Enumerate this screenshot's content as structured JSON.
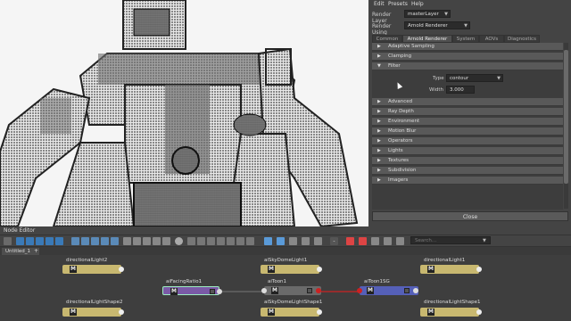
{
  "menubar": {
    "edit": "Edit",
    "presets": "Presets",
    "help": "Help"
  },
  "render_layer": {
    "label": "Render Layer",
    "value": "masterLayer"
  },
  "render_using": {
    "label": "Render Using",
    "value": "Arnold Renderer"
  },
  "tabs": [
    "Common",
    "Arnold Renderer",
    "System",
    "AOVs",
    "Diagnostics"
  ],
  "active_tab": "Arnold Renderer",
  "sections_top": [
    "Adaptive Sampling",
    "Clamping",
    "Filter"
  ],
  "filter": {
    "type_label": "Type",
    "type_value": "contour",
    "width_label": "Width",
    "width_value": "3.000"
  },
  "sections_bottom": [
    "Advanced",
    "Ray Depth",
    "Environment",
    "Motion Blur",
    "Operators",
    "Lights",
    "Textures",
    "Subdivision",
    "Imagers"
  ],
  "close_button": "Close",
  "node_editor": {
    "title": "Node Editor",
    "search_placeholder": "Search...",
    "tab": "Untitled_1",
    "nodes": {
      "dl2": "directionalLight2",
      "sky": "aiSkyDomeLight1",
      "dl1": "directionalLight1",
      "facing": "aiFacingRatio1",
      "toon": "aiToon1",
      "toonsg": "aiToon1SG",
      "dls2": "directionalLightShape2",
      "skyshape": "aiSkyDomeLightShape1",
      "dls1": "directionalLightShape1"
    },
    "node_icon": "M"
  },
  "colors": {
    "facing": "#7a5aa6",
    "toonsg": "#5560b8",
    "light": "#c8b870",
    "connection_red": "#cc2222"
  }
}
